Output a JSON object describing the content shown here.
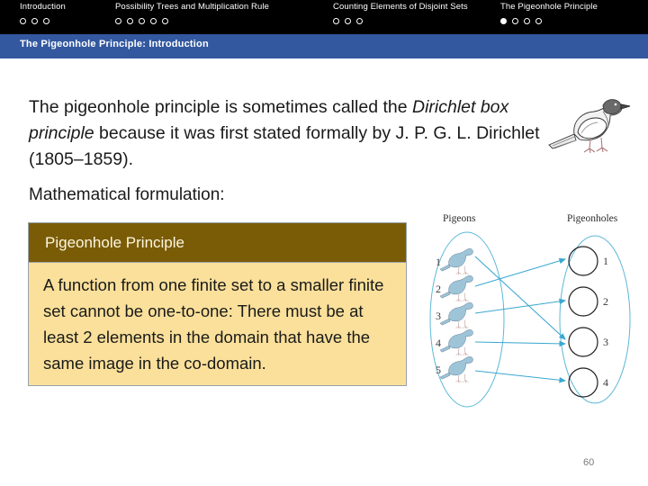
{
  "nav": {
    "sections": [
      {
        "label": "Introduction",
        "dots": 3,
        "active_index": -1
      },
      {
        "label": "Possibility Trees and Multiplication Rule",
        "dots": 5,
        "active_index": -1
      },
      {
        "label": "Counting Elements of Disjoint Sets",
        "dots": 3,
        "active_index": -1
      },
      {
        "label": "The Pigeonhole Principle",
        "dots": 4,
        "active_index": 0
      }
    ]
  },
  "title_bar": {
    "text": "The Pigeonhole Principle: Introduction",
    "background_color": "#33589f",
    "text_color": "#ffffff"
  },
  "body": {
    "intro_before_italic": "The pigeonhole principle is sometimes called the ",
    "intro_italic": "Dirichlet box principle",
    "intro_after_italic": " because it was first stated formally by J. P. G. L. Dirichlet (1805–1859).",
    "math_formulation_label": "Mathematical formulation:"
  },
  "callout": {
    "header": "Pigeonhole Principle",
    "header_color": "#7a5c07",
    "body_color": "#fae09a",
    "body": "A function from one finite set to a smaller finite set cannot be one-to-one: There must be at least 2 elements in the domain that have the same image in the co-domain."
  },
  "diagram": {
    "left_label": "Pigeons",
    "right_label": "Pigeonholes",
    "pigeon_indices": [
      "1",
      "2",
      "3",
      "4",
      "5"
    ],
    "hole_indices": [
      "1",
      "2",
      "3",
      "4"
    ],
    "mapping": [
      {
        "from": "1",
        "to": "3"
      },
      {
        "from": "2",
        "to": "1"
      },
      {
        "from": "3",
        "to": "2"
      },
      {
        "from": "4",
        "to": "3"
      },
      {
        "from": "5",
        "to": "4"
      }
    ],
    "accent_color": "#5cb8d8"
  },
  "footer": {
    "page_number": "60"
  },
  "icons": {
    "pigeon": "pigeon-icon",
    "nav_dot": "nav-dot-icon"
  }
}
